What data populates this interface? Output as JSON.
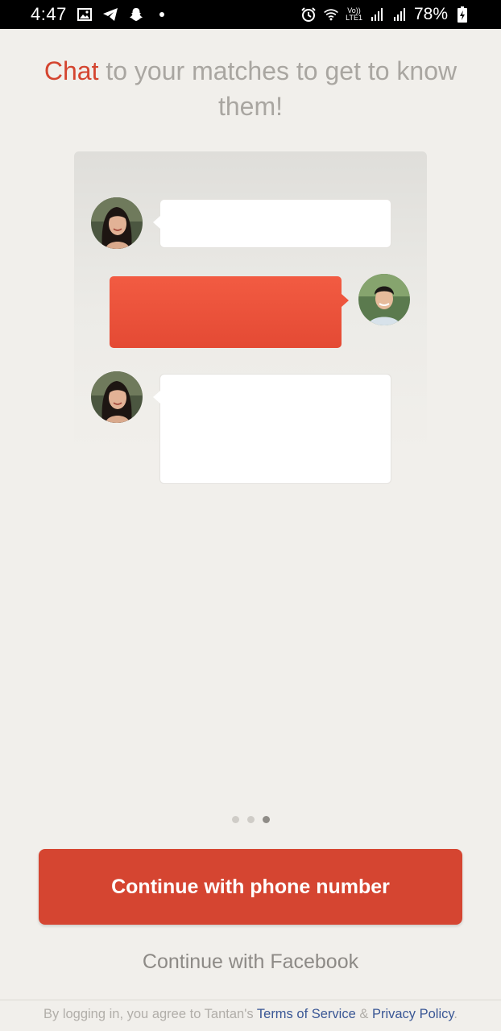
{
  "status_bar": {
    "time": "4:47",
    "battery": "78%",
    "left_icons": [
      "image-icon",
      "telegram-icon",
      "snapchat-icon",
      "dot-icon"
    ],
    "right_icons": [
      "alarm-icon",
      "wifi-icon",
      "volte-icon",
      "signal-icon",
      "signal-icon",
      "battery-icon"
    ],
    "volte_top": "Vo))",
    "volte_bottom": "LTE1"
  },
  "headline": {
    "accent": "Chat",
    "rest": " to your matches to get to know them!"
  },
  "colors": {
    "brand_red": "#d54531",
    "accent_text": "#d44530",
    "muted_text": "#a9a6a1",
    "link_blue": "#3a5795",
    "background": "#f1efeb"
  },
  "pager": {
    "total": 3,
    "active_index": 2
  },
  "buttons": {
    "phone": "Continue with phone number",
    "facebook": "Continue with Facebook"
  },
  "legal": {
    "prefix": "By logging in, you agree to Tantan's ",
    "terms": "Terms of Service",
    "amp": " & ",
    "privacy": "Privacy Policy",
    "suffix": "."
  }
}
